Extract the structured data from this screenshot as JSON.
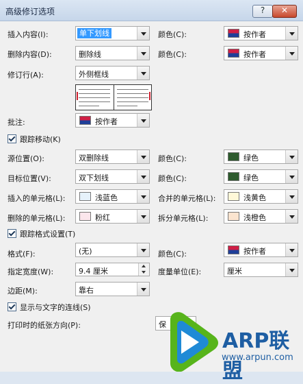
{
  "window": {
    "title": "高级修订选项",
    "help_glyph": "?",
    "close_glyph": "✕"
  },
  "insertions": {
    "label": "插入内容(I):",
    "value": "单下划线",
    "color_label": "颜色(C):",
    "color_value": "按作者"
  },
  "deletions": {
    "label": "删除内容(D):",
    "value": "删除线",
    "color_label": "颜色(C):",
    "color_value": "按作者"
  },
  "changed_lines": {
    "label": "修订行(A):",
    "value": "外侧框线"
  },
  "comments": {
    "label": "批注:",
    "color_value": "按作者"
  },
  "track_moves": {
    "label": "跟踪移动(K)",
    "checked": true
  },
  "moved_from": {
    "label": "源位置(O):",
    "value": "双删除线",
    "color_label": "颜色(C):",
    "color_value": "绿色",
    "swatch_color": "#2e5b2e"
  },
  "moved_to": {
    "label": "目标位置(V):",
    "value": "双下划线",
    "color_label": "颜色(C):",
    "color_value": "绿色",
    "swatch_color": "#2e5b2e"
  },
  "inserted_cells": {
    "label": "插入的单元格(L):",
    "value": "浅蓝色",
    "swatch_color": "#e6f2fb"
  },
  "merged_cells": {
    "label": "合并的单元格(L):",
    "value": "浅黄色",
    "swatch_color": "#fff8d8"
  },
  "deleted_cells": {
    "label": "删除的单元格(L):",
    "value": "粉红",
    "swatch_color": "#fbe6ec"
  },
  "split_cells": {
    "label": "拆分单元格(L):",
    "value": "浅橙色",
    "swatch_color": "#fbe4cf"
  },
  "track_formatting": {
    "label": "跟踪格式设置(T)",
    "checked": true
  },
  "formatting": {
    "label": "格式(F):",
    "value": "(无)",
    "color_label": "颜色(C):",
    "color_value": "按作者"
  },
  "width": {
    "label": "指定宽度(W):",
    "value": "9.4 厘米",
    "unit_label": "度量单位(E):",
    "unit_value": "厘米"
  },
  "margin": {
    "label": "边距(M):",
    "value": "靠右"
  },
  "show_lines": {
    "label": "显示与文字的连线(S)",
    "checked": true
  },
  "paper_orientation": {
    "label": "打印时的纸张方向(P):",
    "value": "保"
  },
  "watermark": {
    "brand": "ARP联盟",
    "url": "www.arpun.com",
    "colors": {
      "text": "#1e5ea3",
      "play_green": "#57b41b",
      "play_blue": "#1f8ad6"
    }
  }
}
